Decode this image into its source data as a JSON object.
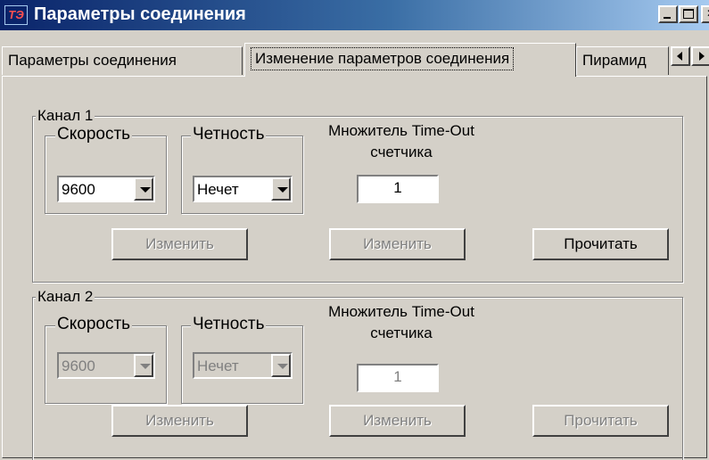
{
  "window": {
    "title": "Параметры соединения",
    "icon_text": "ТЭ",
    "accent_color": "#0a246a"
  },
  "tabs": [
    {
      "label": "Параметры соединения",
      "active": false
    },
    {
      "label": "Изменение параметров соединения",
      "active": true
    },
    {
      "label": "Пирамид",
      "active": false
    }
  ],
  "channel1": {
    "title": "Канал 1",
    "speed": {
      "label": "Скорость",
      "value": "9600"
    },
    "parity": {
      "label": "Четность",
      "value": "Нечет"
    },
    "timeout": {
      "label_line1": "Множитель Time-Out",
      "label_line2": "счетчика",
      "value": "1"
    },
    "buttons": {
      "change_speed": "Изменить",
      "change_timeout": "Изменить",
      "read": "Прочитать"
    }
  },
  "channel2": {
    "title": "Канал 2",
    "speed": {
      "label": "Скорость",
      "value": "9600"
    },
    "parity": {
      "label": "Четность",
      "value": "Нечет"
    },
    "timeout": {
      "label_line1": "Множитель Time-Out",
      "label_line2": "счетчика",
      "value": "1"
    },
    "buttons": {
      "change_speed": "Изменить",
      "change_timeout": "Изменить",
      "read": "Прочитать"
    }
  }
}
